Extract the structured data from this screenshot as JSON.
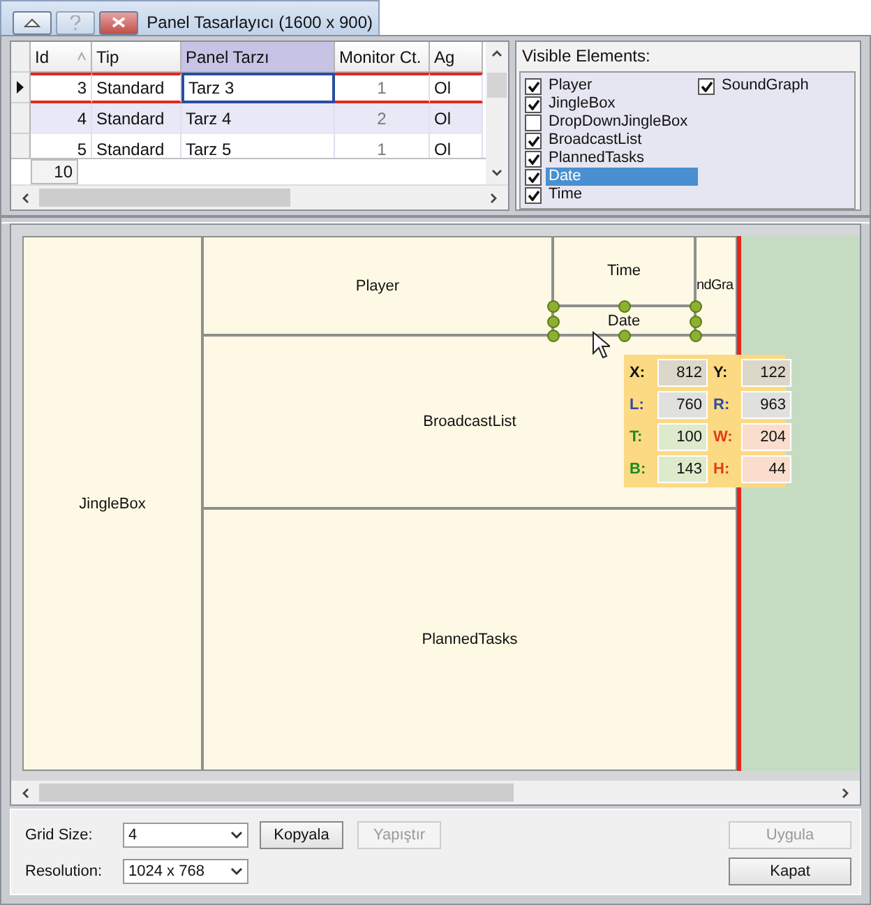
{
  "window": {
    "title": "Panel Tasarlayıcı (1600 x 900)"
  },
  "grid": {
    "columns": [
      {
        "label": "Id",
        "sorted": true,
        "selected": false
      },
      {
        "label": "Tip",
        "sorted": false,
        "selected": false
      },
      {
        "label": "Panel Tarzı",
        "sorted": false,
        "selected": true
      },
      {
        "label": "Monitor Ct.",
        "sorted": false,
        "selected": false
      },
      {
        "label": "Ag",
        "sorted": false,
        "selected": false
      }
    ],
    "rows": [
      {
        "cells": [
          "3",
          "Standard",
          "Tarz 3",
          "1",
          "Ol"
        ],
        "selected": true
      },
      {
        "cells": [
          "4",
          "Standard",
          "Tarz 4",
          "2",
          "Ol"
        ],
        "selected": false
      },
      {
        "cells": [
          "5",
          "Standard",
          "Tarz 5",
          "1",
          "Ol"
        ],
        "selected": false
      }
    ],
    "footer": "10"
  },
  "visible_elements": {
    "title": "Visible Elements:",
    "items": [
      {
        "label": "Player",
        "checked": true,
        "selected": false
      },
      {
        "label": "JingleBox",
        "checked": true,
        "selected": false
      },
      {
        "label": "DropDownJingleBox",
        "checked": false,
        "selected": false
      },
      {
        "label": "BroadcastList",
        "checked": true,
        "selected": false
      },
      {
        "label": "PlannedTasks",
        "checked": true,
        "selected": false
      },
      {
        "label": "Date",
        "checked": true,
        "selected": true
      },
      {
        "label": "Time",
        "checked": true,
        "selected": false
      },
      {
        "label": "SoundGraph",
        "checked": true,
        "selected": false
      }
    ]
  },
  "canvas": {
    "panels": [
      {
        "label": "JingleBox",
        "selected": false
      },
      {
        "label": "Player",
        "selected": false
      },
      {
        "label": "Time",
        "selected": false
      },
      {
        "label": "ndGra",
        "selected": false
      },
      {
        "label": "Date",
        "selected": true
      },
      {
        "label": "BroadcastList",
        "selected": false
      },
      {
        "label": "PlannedTasks",
        "selected": false
      }
    ],
    "info": [
      {
        "label": "X:",
        "value": "812",
        "color": "#111111"
      },
      {
        "label": "Y:",
        "value": "122",
        "color": "#111111"
      },
      {
        "label": "L:",
        "value": "760",
        "color": "#2f4aa0"
      },
      {
        "label": "R:",
        "value": "963",
        "color": "#2f4aa0"
      },
      {
        "label": "T:",
        "value": "100",
        "color": "#1f8a1f"
      },
      {
        "label": "W:",
        "value": "204",
        "color": "#e03c1c"
      },
      {
        "label": "B:",
        "value": "143",
        "color": "#1f8a1f"
      },
      {
        "label": "H:",
        "value": "44",
        "color": "#e03c1c"
      }
    ]
  },
  "settings": {
    "grid_size": {
      "label": "Grid Size:",
      "value": "4"
    },
    "resolution": {
      "label": "Resolution:",
      "value": "1024 x 768"
    }
  },
  "buttons": [
    {
      "label": "Kopyala",
      "disabled": false
    },
    {
      "label": "Yapıştır",
      "disabled": true
    },
    {
      "label": "Uygula",
      "disabled": true
    },
    {
      "label": "Kapat",
      "disabled": false
    }
  ]
}
